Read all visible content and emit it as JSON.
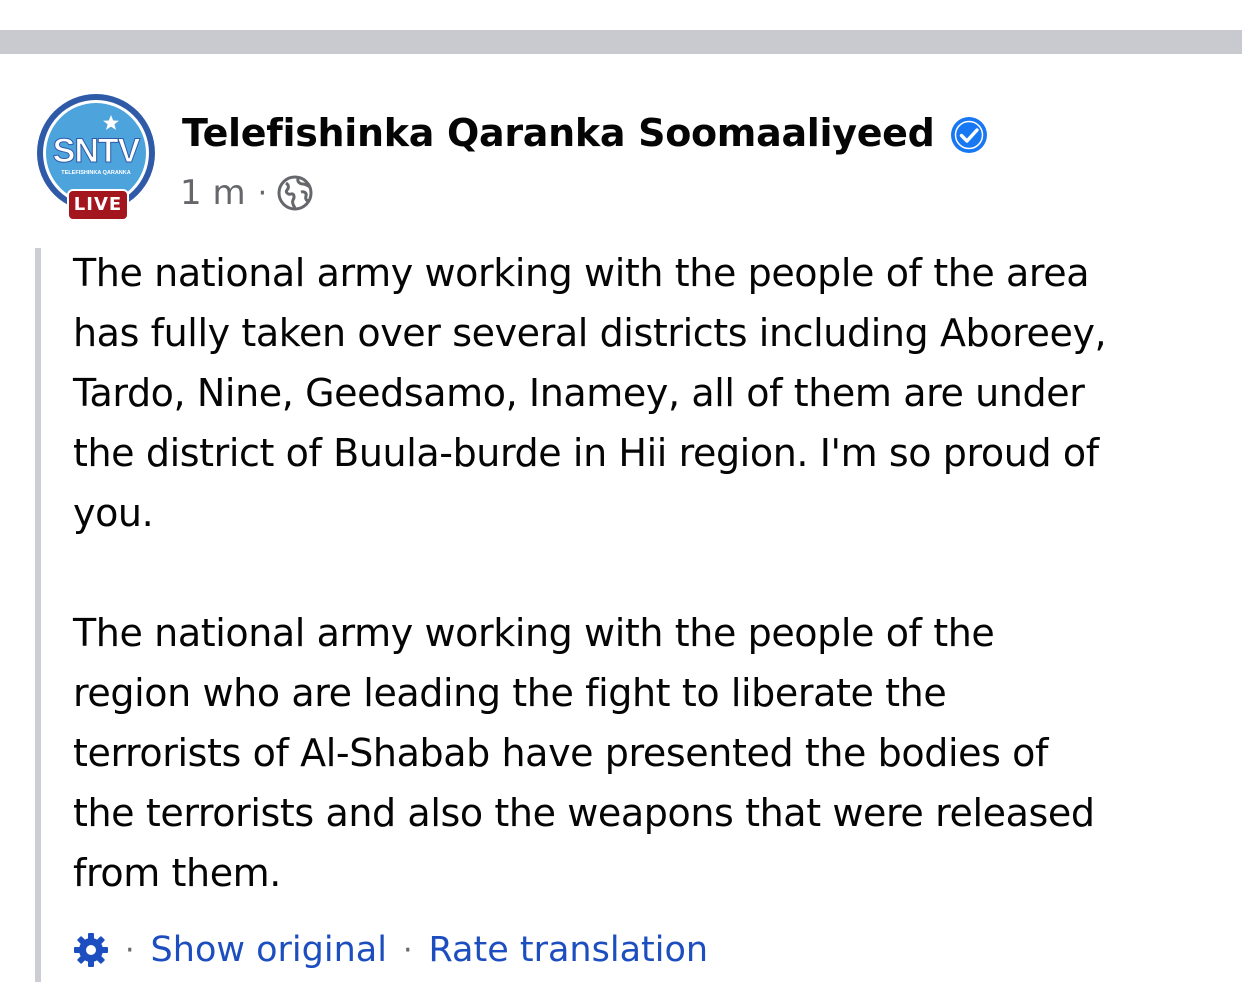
{
  "post": {
    "page_name": "Telefishinka Qaranka Soomaaliyeed",
    "verified_icon": "verified-badge-icon",
    "timestamp": "1 m",
    "meta_separator": "·",
    "audience_icon": "globe-icon",
    "avatar": {
      "logo_text": "SNTV",
      "logo_subtext": "TELEFISHINKA QARANKA",
      "live_label": "LIVE",
      "colors": {
        "ring": "#2e5aa8",
        "fill": "#4da3dc",
        "live": "#a4161d"
      }
    },
    "paragraphs": [
      "The national army working with the people of the area\nhas fully taken over several districts including Aboreey,\nTardo, Nine, Geedsamo, Inamey, all of them are under\nthe district of Buula-burde in Hii region. I'm so proud of\nyou.",
      "The national army working with the people of the\nregion who are leading the fight to liberate the\nterrorists of Al-Shabab have presented the bodies of\nthe terrorists and also the weapons that were released\nfrom them."
    ],
    "translation": {
      "settings_icon": "gear-icon",
      "separator": "·",
      "show_original_label": "Show original",
      "rate_translation_label": "Rate translation"
    }
  },
  "colors": {
    "link": "#1d4ebf",
    "meta_text": "#65676b",
    "verified": "#1877f2",
    "divider_band": "#c9cacf"
  }
}
